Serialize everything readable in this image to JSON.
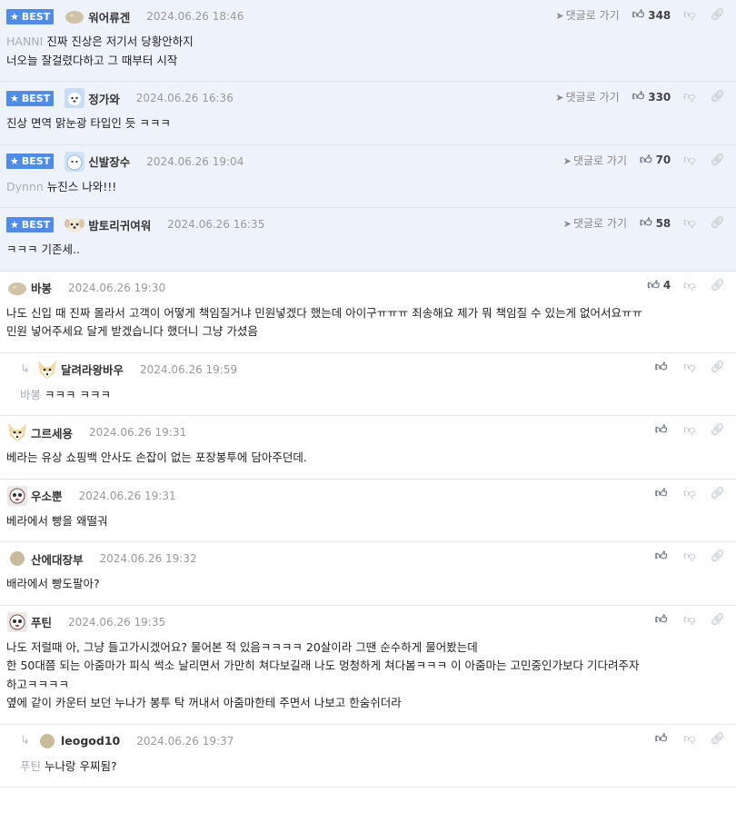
{
  "labels": {
    "best": "BEST",
    "goto": "댓글로 가기"
  },
  "comments": [
    {
      "best": true,
      "nick": "워어류겐",
      "date": "2024.06.26 18:46",
      "likes": "348",
      "mention": "HANNI",
      "lines": [
        "진짜 진상은 저기서 당황안하지",
        "너오늘 잘걸렸다하고 그 때부터 시작"
      ],
      "avatar": "blob-avatar"
    },
    {
      "best": true,
      "nick": "정가와",
      "date": "2024.06.26 16:36",
      "likes": "330",
      "mention": "",
      "lines": [
        "진상 면역 맑눈광 타입인 듯 ㅋㅋㅋ"
      ],
      "avatar": "dog-avatar"
    },
    {
      "best": true,
      "nick": "신발장수",
      "date": "2024.06.26 19:04",
      "likes": "70",
      "mention": "Dynnn",
      "lines": [
        "뉴진스 나와!!!"
      ],
      "avatar": "bear-avatar"
    },
    {
      "best": true,
      "nick": "밤토리귀여워",
      "date": "2024.06.26 16:35",
      "likes": "58",
      "mention": "",
      "lines": [
        "ㅋㅋㅋ 기존세.."
      ],
      "avatar": "puppy-avatar"
    },
    {
      "best": false,
      "nick": "바봉",
      "date": "2024.06.26 19:30",
      "likes": "4",
      "mention": "",
      "lines": [
        "나도 신입 때 진짜 몰라서 고객이 어떻게 책임질거냐 민원넣겠다 했는데 아이구ㅠㅠㅠ 죄송해요 제가 뭐 책임질 수 있는게 없어서요ㅠㅠ",
        "민원 넣어주세요 달게 받겠습니다 했더니 그냥 가셨음"
      ],
      "avatar": "blob-avatar"
    },
    {
      "best": false,
      "reply": true,
      "nick": "달려라왕바우",
      "date": "2024.06.26 19:59",
      "likes": "",
      "mention": "바봉",
      "lines": [
        "ㅋㅋㅋ ㅋㅋㅋ"
      ],
      "avatar": "fox-avatar"
    },
    {
      "best": false,
      "nick": "그르세용",
      "date": "2024.06.26 19:31",
      "likes": "",
      "mention": "",
      "lines": [
        "베라는 유상 쇼핑백 안사도 손잡이 없는 포장봉투에 담아주던데."
      ],
      "avatar": "fox-avatar"
    },
    {
      "best": false,
      "nick": "우소뿐",
      "date": "2024.06.26 19:31",
      "likes": "",
      "mention": "",
      "lines": [
        "베라에서 빵을 왜떨궈"
      ],
      "avatar": "panda-avatar"
    },
    {
      "best": false,
      "nick": "산에대장부",
      "date": "2024.06.26 19:32",
      "likes": "",
      "mention": "",
      "lines": [
        "배라에서 빵도팔아?"
      ],
      "avatar": "round-avatar"
    },
    {
      "best": false,
      "nick": "푸틴",
      "date": "2024.06.26 19:35",
      "likes": "",
      "mention": "",
      "lines": [
        "나도 저럴때 아, 그냥 들고가시겠어요? 물어본 적 있음ㅋㅋㅋㅋ 20살이라 그땐 순수하게 물어봤는데",
        "한 50대쯤 되는 아줌마가 피식 썩소 날리면서 가만히 쳐다보길래 나도 멍청하게 쳐다봄ㅋㅋㅋ 이 아줌마는 고민중인가보다 기다려주자",
        "하고ㅋㅋㅋㅋ",
        "옆에 같이 카운터 보던 누나가 봉투 탁 꺼내서 아줌마한테 주면서 나보고 한숨쉬더라"
      ],
      "avatar": "panda-avatar"
    },
    {
      "best": false,
      "reply": true,
      "nick": "leogod10",
      "date": "2024.06.26 19:37",
      "likes": "",
      "mention": "푸틴",
      "lines": [
        "누나랑 우찌됨?"
      ],
      "avatar": "round-avatar"
    }
  ]
}
